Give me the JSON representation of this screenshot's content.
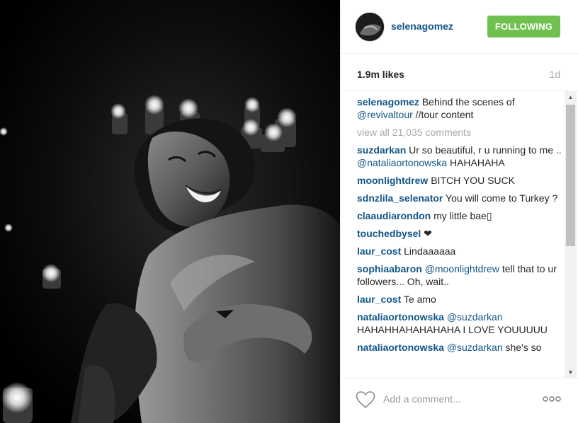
{
  "post": {
    "username": "selenagomez",
    "follow_label": "FOLLOWING",
    "likes": "1.9m likes",
    "age": "1d"
  },
  "caption": {
    "author": "selenagomez",
    "text_before": " Behind the scenes of ",
    "mention": "@revivaltour",
    "text_after": " //tour content"
  },
  "view_all": "view all 21,035 comments",
  "comments": [
    {
      "author": "suzdarkan",
      "text": " Ur so beautiful, r u running to me .. ",
      "mention": "@nataliaortonowska",
      "text_after": " HAHAHAHA"
    },
    {
      "author": "moonlightdrew",
      "text": " BITCH YOU SUCK",
      "mention": "",
      "text_after": ""
    },
    {
      "author": "sdnzlila_selenator",
      "text": " You will come to Turkey ?",
      "mention": "",
      "text_after": ""
    },
    {
      "author": "claaudiarondon",
      "text": " my little bae▯",
      "mention": "",
      "text_after": ""
    },
    {
      "author": "touchedbysel",
      "text": " ❤",
      "mention": "",
      "text_after": ""
    },
    {
      "author": "laur_cost",
      "text": " Lindaaaaaa",
      "mention": "",
      "text_after": ""
    },
    {
      "author": "sophiaabaron",
      "text": " ",
      "mention": "@moonlightdrew",
      "text_after": " tell that to ur followers... Oh, wait.."
    },
    {
      "author": "laur_cost",
      "text": " Te amo",
      "mention": "",
      "text_after": ""
    },
    {
      "author": "nataliaortonowska",
      "text": " ",
      "mention": "@suzdarkan",
      "text_after": " HAHAHHAHAHAHAHA I LOVE YOUUUUU"
    },
    {
      "author": "nataliaortonowska",
      "text": " ",
      "mention": "@suzdarkan",
      "text_after": " she's so"
    }
  ],
  "comment_box": {
    "placeholder": "Add a comment..."
  },
  "icons": {
    "like": "heart-icon",
    "more": "more-options-icon",
    "scroll_up": "scroll-up-arrow-icon",
    "scroll_down": "scroll-down-arrow-icon"
  },
  "colors": {
    "follow_button": "#70c050",
    "username_link": "#125688",
    "muted_text": "#a5a7aa"
  }
}
